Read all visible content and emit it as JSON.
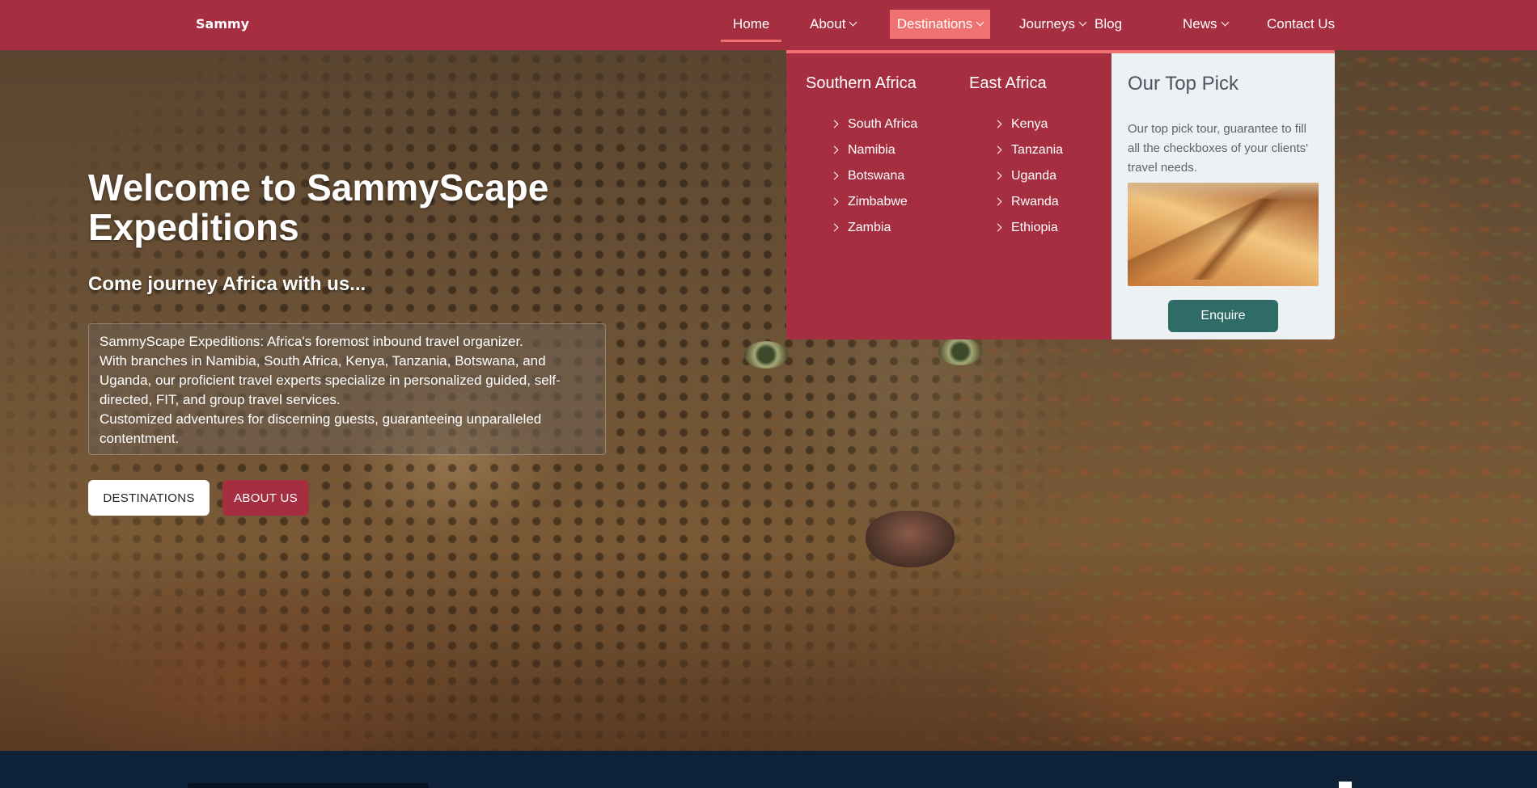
{
  "navbar": {
    "brand": "Sammy",
    "items": [
      {
        "label": "Home",
        "active": true
      },
      {
        "label": "About",
        "dropdown": true
      },
      {
        "label": "Destinations",
        "dropdown": true,
        "open": true
      },
      {
        "label": "Journeys",
        "dropdown": true
      },
      {
        "label": "Blog"
      },
      {
        "label": "News",
        "dropdown": true
      },
      {
        "label": "Contact Us"
      }
    ]
  },
  "hero": {
    "title": "Welcome to SammyScape Expeditions",
    "subtitle": "Come journey Africa with us...",
    "description": [
      "SammyScape Expeditions: Africa's foremost inbound travel organizer.",
      "With branches in Namibia, South Africa, Kenya, Tanzania, Botswana, and Uganda, our proficient travel experts specialize in personalized guided, self-directed, FIT, and group travel services.",
      "Customized adventures for discerning guests, guaranteeing unparalleled contentment."
    ],
    "buttons": {
      "destinations": "DESTINATIONS",
      "about": "ABOUT US"
    }
  },
  "mega_menu": {
    "columns": [
      {
        "heading": "Southern Africa",
        "items": [
          "South Africa",
          "Namibia",
          "Botswana",
          "Zimbabwe",
          "Zambia"
        ]
      },
      {
        "heading": "East Africa",
        "items": [
          "Kenya",
          "Tanzania",
          "Uganda",
          "Rwanda",
          "Ethiopia"
        ]
      }
    ],
    "top_pick": {
      "heading": "Our Top Pick",
      "text": "Our top pick tour, guarantee to fill all the checkboxes of your clients' travel needs.",
      "button": "Enquire"
    }
  },
  "colors": {
    "primary": "#a52e40",
    "accent": "#f07270",
    "enquire": "#2f6b67",
    "footer": "#0d2238"
  }
}
